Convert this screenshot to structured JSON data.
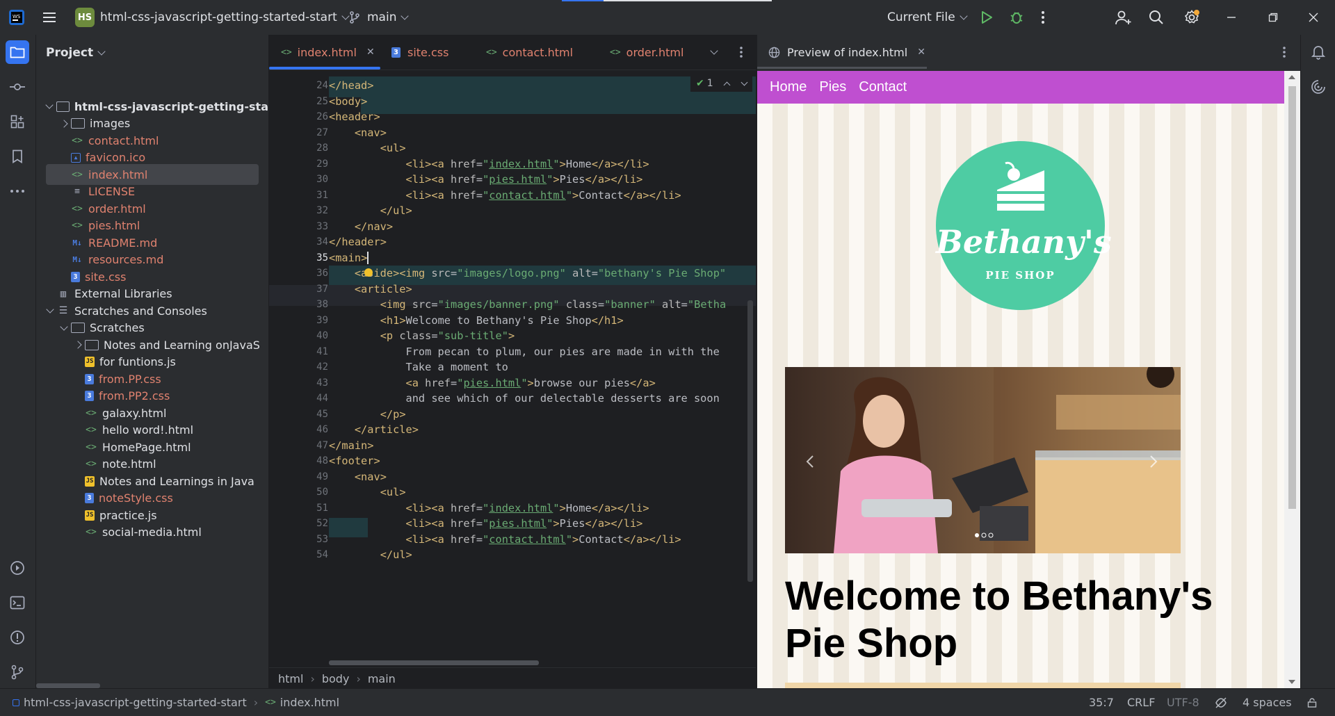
{
  "titlebar": {
    "project_badge": "HS",
    "project_name": "html-css-javascript-getting-started-start",
    "branch": "main",
    "run_config": "Current File"
  },
  "project_panel": {
    "title": "Project",
    "items": [
      {
        "label": "html-css-javascript-getting-sta",
        "kind": "folder",
        "open": true,
        "bold": true
      },
      {
        "label": "images",
        "kind": "folder",
        "open": false
      },
      {
        "label": "contact.html",
        "kind": "html"
      },
      {
        "label": "favicon.ico",
        "kind": "ico"
      },
      {
        "label": "index.html",
        "kind": "html",
        "selected": true
      },
      {
        "label": "LICENSE",
        "kind": "text"
      },
      {
        "label": "order.html",
        "kind": "html"
      },
      {
        "label": "pies.html",
        "kind": "html"
      },
      {
        "label": "README.md",
        "kind": "md"
      },
      {
        "label": "resources.md",
        "kind": "md"
      },
      {
        "label": "site.css",
        "kind": "css"
      },
      {
        "label": "External Libraries",
        "kind": "lib"
      },
      {
        "label": "Scratches and Consoles",
        "kind": "scratch",
        "open": true
      },
      {
        "label": "Scratches",
        "kind": "folder",
        "open": true
      },
      {
        "label": "Notes and Learning onJavaS",
        "kind": "folder",
        "open": false
      },
      {
        "label": "for funtions.js",
        "kind": "js"
      },
      {
        "label": "from.PP.css",
        "kind": "css"
      },
      {
        "label": "from.PP2.css",
        "kind": "css"
      },
      {
        "label": "galaxy.html",
        "kind": "html2"
      },
      {
        "label": "hello word!.html",
        "kind": "html2"
      },
      {
        "label": "HomePage.html",
        "kind": "html2"
      },
      {
        "label": "note.html",
        "kind": "html2"
      },
      {
        "label": "Notes and Learnings in Java",
        "kind": "js"
      },
      {
        "label": "noteStyle.css",
        "kind": "css"
      },
      {
        "label": "practice.js",
        "kind": "js"
      },
      {
        "label": "social-media.html",
        "kind": "html2"
      }
    ]
  },
  "editor": {
    "tabs": [
      {
        "label": "index.html",
        "active": true
      },
      {
        "label": "site.css"
      },
      {
        "label": "contact.html"
      },
      {
        "label": "order.html"
      }
    ],
    "inspection_count": "1",
    "lines": [
      {
        "n": "24",
        "text": "</head>"
      },
      {
        "n": "25",
        "text": "<body>"
      },
      {
        "n": "26",
        "text": "<header>"
      },
      {
        "n": "27",
        "text": "    <nav>"
      },
      {
        "n": "28",
        "text": "        <ul>"
      },
      {
        "n": "29",
        "text": "            <li><a href=\"index.html\">Home</a></li>"
      },
      {
        "n": "30",
        "text": "            <li><a href=\"pies.html\">Pies</a></li>"
      },
      {
        "n": "31",
        "text": "            <li><a href=\"contact.html\">Contact</a></li>"
      },
      {
        "n": "32",
        "text": "        </ul>"
      },
      {
        "n": "33",
        "text": "    </nav>"
      },
      {
        "n": "34",
        "text": "</header>"
      },
      {
        "n": "35",
        "text": "<main>"
      },
      {
        "n": "36",
        "text": "    <aside><img src=\"images/logo.png\" alt=\"bethany's Pie Shop\""
      },
      {
        "n": "37",
        "text": "    <article>"
      },
      {
        "n": "38",
        "text": "        <img src=\"images/banner.png\" class=\"banner\" alt=\"Betha"
      },
      {
        "n": "39",
        "text": "        <h1>Welcome to Bethany's Pie Shop</h1>"
      },
      {
        "n": "40",
        "text": "        <p class=\"sub-title\">"
      },
      {
        "n": "41",
        "text": "            From pecan to plum, our pies are made in with the"
      },
      {
        "n": "42",
        "text": "            Take a moment to"
      },
      {
        "n": "43",
        "text": "            <a href=\"pies.html\">browse our pies</a>"
      },
      {
        "n": "44",
        "text": "            and see which of our delectable desserts are soon"
      },
      {
        "n": "45",
        "text": "        </p>"
      },
      {
        "n": "46",
        "text": "    </article>"
      },
      {
        "n": "47",
        "text": "</main>"
      },
      {
        "n": "48",
        "text": "<footer>"
      },
      {
        "n": "49",
        "text": "    <nav>"
      },
      {
        "n": "50",
        "text": "        <ul>"
      },
      {
        "n": "51",
        "text": "            <li><a href=\"index.html\">Home</a></li>"
      },
      {
        "n": "52",
        "text": "            <li><a href=\"pies.html\">Pies</a></li>"
      },
      {
        "n": "53",
        "text": "            <li><a href=\"contact.html\">Contact</a></li>"
      },
      {
        "n": "54",
        "text": "        </ul>"
      }
    ],
    "breadcrumb": [
      "html",
      "body",
      "main"
    ]
  },
  "preview": {
    "tab_label": "Preview of index.html",
    "nav": [
      "Home",
      "Pies",
      "Contact"
    ],
    "logo_text": "Bethany's",
    "logo_subtext": "Pie Shop",
    "heading": "Welcome to Bethany's Pie Shop",
    "colors": {
      "nav": "#bf4fd0",
      "logo": "#4ecca3",
      "stripe_light": "#fbf8f3",
      "stripe_dark": "#efe9de"
    }
  },
  "statusbar": {
    "project": "html-css-javascript-getting-started-start",
    "file": "index.html",
    "position": "35:7",
    "line_ending": "CRLF",
    "encoding": "UTF-8",
    "indent": "4 spaces"
  },
  "colors": {
    "accent": "#3574f0",
    "tag": "#d5b778",
    "string": "#6aab73"
  }
}
